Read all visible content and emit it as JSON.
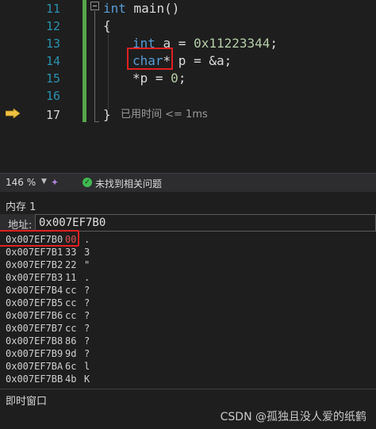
{
  "editor": {
    "lines": [
      {
        "num": "11"
      },
      {
        "num": "12"
      },
      {
        "num": "13"
      },
      {
        "num": "14"
      },
      {
        "num": "15"
      },
      {
        "num": "16"
      },
      {
        "num": "17"
      }
    ],
    "code": {
      "l11_kw": "int",
      "l11_rest": " main()",
      "l12": "{",
      "l13_kw": "int",
      "l13_mid": " a = ",
      "l13_num": "0x11223344",
      "l13_end": ";",
      "l14_kw": "char",
      "l14_rest": "* p = &a;",
      "l15_a": "*p = ",
      "l15_num": "0",
      "l15_end": ";",
      "l17": "}"
    },
    "elapsed": "已用时间 <= 1ms"
  },
  "status": {
    "zoom": "146 %",
    "issues": "未找到相关问题"
  },
  "memory": {
    "title": "内存 1",
    "address_label": "地址:",
    "address_value": "0x007EF7B0",
    "rows": [
      {
        "addr": "0x007EF7B0",
        "byte": "00",
        "ch": "."
      },
      {
        "addr": "0x007EF7B1",
        "byte": "33",
        "ch": "3"
      },
      {
        "addr": "0x007EF7B2",
        "byte": "22",
        "ch": "\""
      },
      {
        "addr": "0x007EF7B3",
        "byte": "11",
        "ch": "."
      },
      {
        "addr": "0x007EF7B4",
        "byte": "cc",
        "ch": "?"
      },
      {
        "addr": "0x007EF7B5",
        "byte": "cc",
        "ch": "?"
      },
      {
        "addr": "0x007EF7B6",
        "byte": "cc",
        "ch": "?"
      },
      {
        "addr": "0x007EF7B7",
        "byte": "cc",
        "ch": "?"
      },
      {
        "addr": "0x007EF7B8",
        "byte": "86",
        "ch": "?"
      },
      {
        "addr": "0x007EF7B9",
        "byte": "9d",
        "ch": "?"
      },
      {
        "addr": "0x007EF7BA",
        "byte": "6c",
        "ch": "l"
      },
      {
        "addr": "0x007EF7BB",
        "byte": "4b",
        "ch": "K"
      }
    ]
  },
  "immediate": {
    "title": "即时窗口"
  },
  "watermark": "CSDN @孤独且没人爱的纸鹤",
  "colors": {
    "changed_byte": "#e05252",
    "highlight_box": "#e02020",
    "keyword": "#569cd6",
    "number": "#b5cea8",
    "line_number": "#2b91af",
    "change_bar": "#57a64a"
  }
}
